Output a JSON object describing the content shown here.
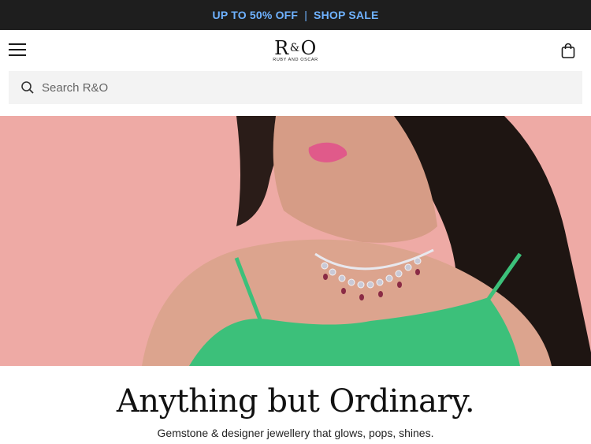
{
  "promo": {
    "offer": "UP TO 50% OFF",
    "separator": "|",
    "cta": "SHOP SALE"
  },
  "header": {
    "logo_mark_left": "R",
    "logo_mark_amp": "&",
    "logo_mark_right": "O",
    "logo_sub": "RUBY AND OSCAR",
    "menu_icon": "hamburger-menu-icon",
    "cart_icon": "shopping-bag-icon"
  },
  "search": {
    "placeholder": "Search R&O",
    "icon": "search-icon"
  },
  "hero": {
    "background_color": "#eeaaa5",
    "dress_color": "#3cc07a"
  },
  "content": {
    "headline": "Anything but Ordinary.",
    "subline": "Gemstone & designer jewellery that glows, pops, shines."
  }
}
